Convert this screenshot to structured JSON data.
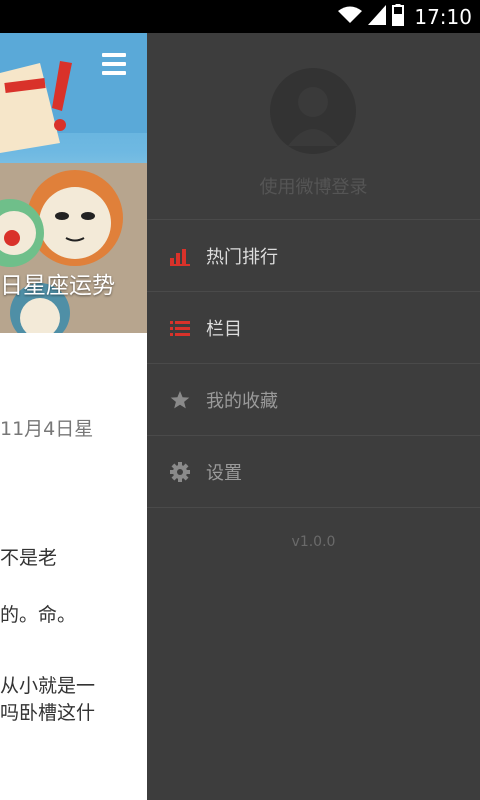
{
  "status_bar": {
    "time": "17:10"
  },
  "hero": {
    "title": "日星座运势"
  },
  "article": {
    "lines": [
      {
        "text": "11月4日星",
        "muted": true
      },
      {
        "text": "不是老"
      },
      {
        "text": "的。命。"
      },
      {
        "text": "从小就是一"
      },
      {
        "text": "吗卧槽这什"
      }
    ]
  },
  "drawer": {
    "login_text": "使用微博登录",
    "items": [
      {
        "label": "热门排行",
        "icon": "bar-chart-icon"
      },
      {
        "label": "栏目",
        "icon": "list-icon"
      },
      {
        "label": "我的收藏",
        "icon": "star-icon"
      },
      {
        "label": "设置",
        "icon": "gear-icon"
      }
    ],
    "version": "v1.0.0"
  },
  "colors": {
    "accent": "#d9322a",
    "drawer_bg": "#3d3d3d"
  }
}
